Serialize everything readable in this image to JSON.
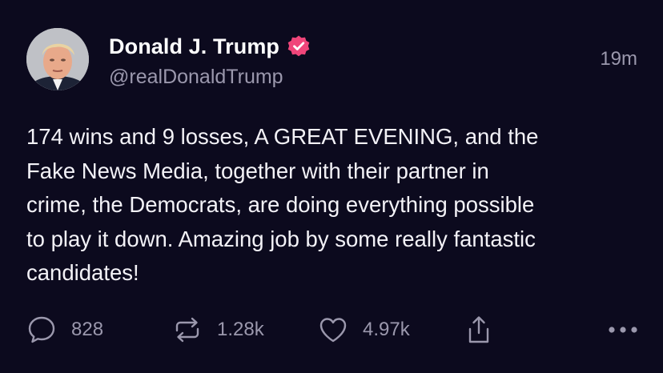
{
  "author": {
    "display_name": "Donald J. Trump",
    "handle": "@realDonaldTrump",
    "verified_badge_color": "#f0457a"
  },
  "post": {
    "timestamp": "19m",
    "text": "174 wins and 9 losses, A GREAT EVENING, and the\nFake News Media, together with their partner in\ncrime, the Democrats, are doing everything possible\nto play it down. Amazing job by some really fantastic\ncandidates!"
  },
  "actions": {
    "reply": {
      "icon": "speech-bubble-icon",
      "count": "828"
    },
    "repost": {
      "icon": "repost-arrows-icon",
      "count": "1.28k"
    },
    "like": {
      "icon": "heart-icon",
      "count": "4.97k"
    },
    "share": {
      "icon": "share-upload-icon"
    },
    "more": {
      "icon": "ellipsis-icon"
    }
  },
  "colors": {
    "background": "#0c0a1e",
    "text": "#f3f2f7",
    "muted": "#9b98ad"
  }
}
